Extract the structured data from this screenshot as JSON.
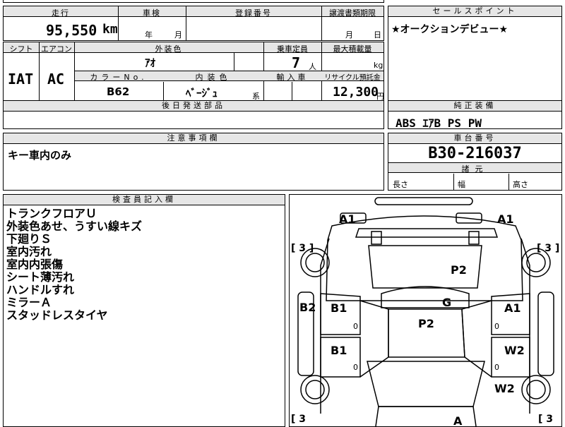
{
  "top": {
    "mileage_label": "走行",
    "mileage_value": "95,550",
    "mileage_unit": "km",
    "inspection_label": "車検",
    "inspection_year_unit": "年",
    "inspection_month_unit": "月",
    "registration_label": "登録番号",
    "transfer_label": "譲渡書類期限",
    "transfer_month_unit": "月",
    "transfer_day_unit": "日"
  },
  "sales_point": {
    "label": "セールスポイント",
    "text": "★オークションデビュー★"
  },
  "spec": {
    "shift_label": "シフト",
    "shift_value": "IAT",
    "ac_label": "エアコン",
    "ac_value": "AC",
    "exterior_label": "外装色",
    "exterior_value": "ｱｵ",
    "capacity_label": "乗車定員",
    "capacity_value": "7",
    "capacity_unit": "人",
    "load_label": "最大積載量",
    "load_unit": "kg",
    "color_no_label": "カラーNo.",
    "color_no_value": "B62",
    "interior_label": "内装色",
    "interior_value": "ﾍﾞｰｼﾞｭ",
    "interior_suffix": "系",
    "import_label": "輸入車",
    "recycle_label": "リサイクル預託金",
    "recycle_value": "12,300",
    "recycle_unit": "円"
  },
  "later_parts": {
    "label": "後日発送部品"
  },
  "equipment": {
    "label": "純正装備",
    "value": "ABS ｴｱB PS PW"
  },
  "notes": {
    "label": "注意事項欄",
    "text": "キー車内のみ"
  },
  "chassis": {
    "label": "車台番号",
    "value": "B30-216037"
  },
  "dimensions": {
    "label": "諸元",
    "length": "長さ",
    "width": "幅",
    "height": "高さ"
  },
  "inspector": {
    "label": "検査員記入欄",
    "lines": [
      "トランクフロアＵ",
      "外装色あせ、うすい線キズ",
      "下廻りＳ",
      "室内汚れ",
      "室内内張傷",
      "シート薄汚れ",
      "ハンドルすれ",
      "ミラーＡ",
      "スタッドレスタイヤ"
    ]
  },
  "diagram": {
    "marks": {
      "a1_rear_left": "A1",
      "a1_rear_right": "A1",
      "p2_rear": "P2",
      "b2": "B2",
      "b1_upper": "B1",
      "g": "G",
      "a1_side": "A1",
      "p2_roof": "P2",
      "b1_lower": "B1",
      "w2_upper": "W2",
      "w2_lower": "W2",
      "a_front": "A"
    },
    "tires": {
      "tl": "[ 3 ]",
      "tr": "[ 3 ]",
      "bl": "[ 3",
      "br": "[ 3"
    },
    "zero": "0"
  }
}
